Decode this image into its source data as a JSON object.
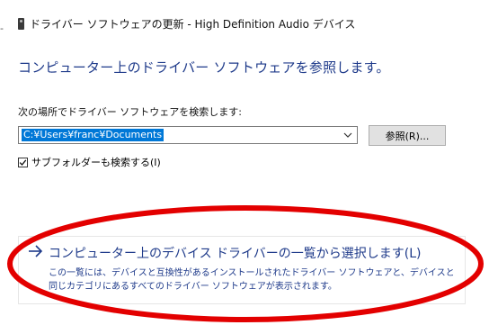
{
  "window": {
    "title_dash": "-",
    "title": "ドライバー ソフトウェアの更新 - High Definition Audio デバイス"
  },
  "main": {
    "heading": "コンピューター上のドライバー ソフトウェアを参照します。",
    "search_label": "次の場所でドライバー ソフトウェアを検索します:",
    "path_value": "C:¥Users¥franc¥Documents",
    "browse_label": "参照(R)...",
    "subfolder_label": "サブフォルダーも検索する(I)",
    "subfolder_checked": true
  },
  "pick_option": {
    "title": "コンピューター上のデバイス ドライバーの一覧から選択します(L)",
    "description": "この一覧には、デバイスと互換性があるインストールされたドライバー ソフトウェアと、デバイスと同じカテゴリにあるすべてのドライバー ソフトウェアが表示されます。"
  },
  "colors": {
    "link_blue": "#1e3a8a",
    "selection_blue": "#0078d7",
    "annotation_red": "#e30000"
  },
  "icons": {
    "device": "audio-device-icon",
    "combo": "chevron-down-icon",
    "option": "arrow-right-icon"
  }
}
